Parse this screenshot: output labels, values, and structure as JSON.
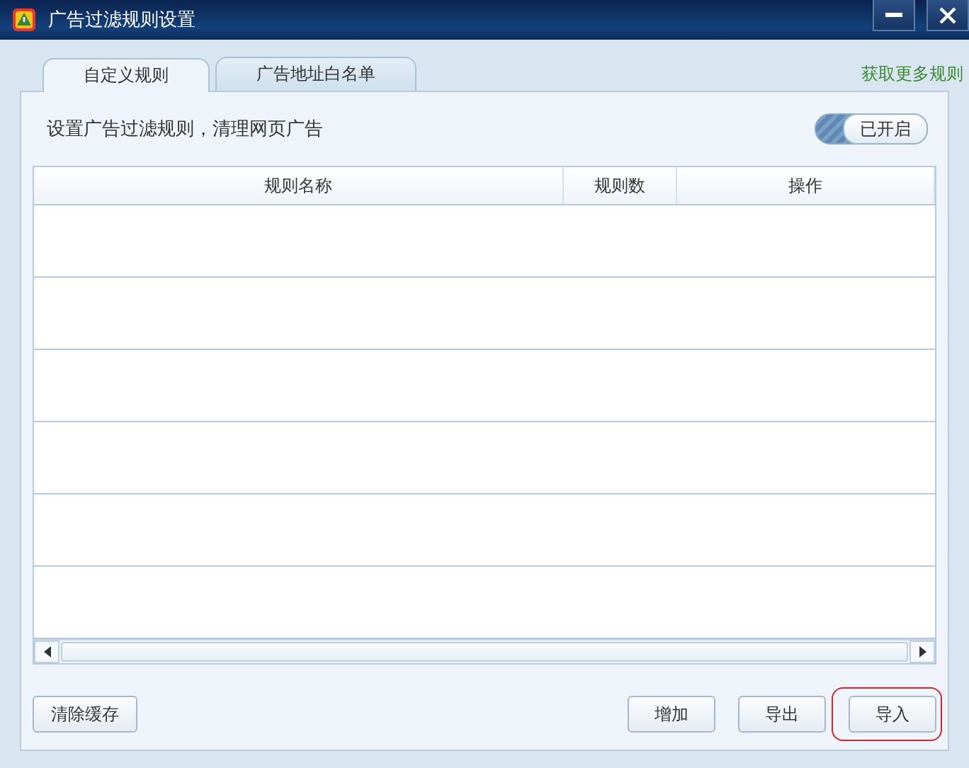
{
  "window": {
    "title": "广告过滤规则设置",
    "controls": [
      {
        "kind": "minimize"
      },
      {
        "kind": "close"
      }
    ]
  },
  "tabs": [
    {
      "label": "自定义规则",
      "selected": true
    },
    {
      "label": "广告地址白名单",
      "selected": false
    }
  ],
  "more_link": "获取更多规则",
  "description": "设置广告过滤规则，清理网页广告",
  "toggle": {
    "label": "已开启",
    "on": true
  },
  "table": {
    "columns": [
      "规则名称",
      "规则数",
      "操作"
    ]
  },
  "buttons_left": [
    {
      "label": "清除缓存",
      "highlighted": false
    }
  ],
  "buttons_right": [
    {
      "label": "增加",
      "highlighted": false
    },
    {
      "label": "导出",
      "highlighted": false
    },
    {
      "label": "导入",
      "highlighted": true
    }
  ]
}
